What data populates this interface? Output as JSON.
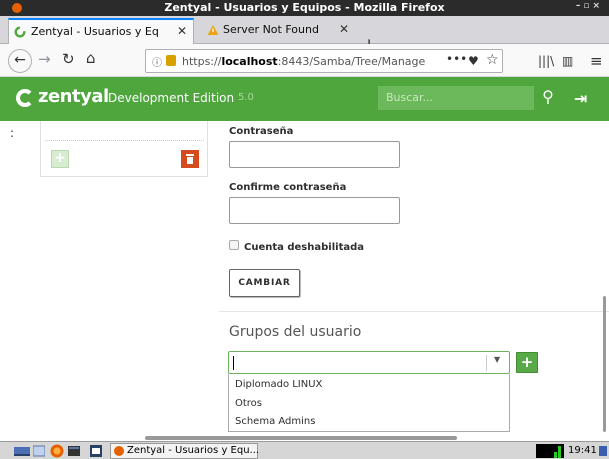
{
  "window": {
    "title": "Zentyal - Usuarios y Equipos - Mozilla Firefox"
  },
  "tabs": [
    {
      "label": "Zentyal - Usuarios y Equi",
      "active": true
    },
    {
      "label": "Server Not Found",
      "active": false
    }
  ],
  "navbar": {
    "url_prefix": "https://",
    "url_host": "localhost",
    "url_rest": ":8443/Samba/Tree/Manage",
    "icons": [
      "back-icon",
      "forward-icon",
      "reload-icon",
      "home-icon",
      "info-icon",
      "lock-icon",
      "more-icon",
      "pocket-icon",
      "bookmark-star-icon",
      "library-icon",
      "sidebar-icon",
      "menu-icon"
    ]
  },
  "zentyal": {
    "logo_text": "zentyal",
    "edition": "Development Edition",
    "version": "5.0",
    "search_placeholder": "Buscar...",
    "brand_color": "#4ea63d"
  },
  "sidebar": {
    "colon": ":"
  },
  "form": {
    "password_label": "Contraseña",
    "confirm_label": "Confirme contraseña",
    "disabled_label": "Cuenta deshabilitada",
    "disabled_checked": false,
    "submit_label": "CAMBIAR"
  },
  "groups": {
    "section_title": "Grupos del usuario",
    "combo_value": "",
    "options": [
      "Diplomado LINUX",
      "Otros",
      "Schema Admins"
    ]
  },
  "taskbar": {
    "task_label": "Zentyal - Usuarios y Equ...",
    "clock": "19:41"
  }
}
